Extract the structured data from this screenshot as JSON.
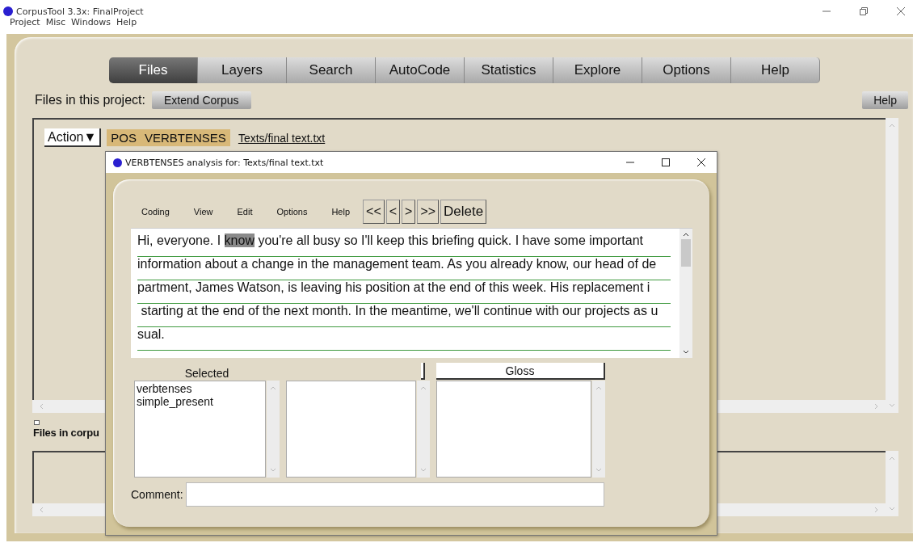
{
  "window": {
    "title": "CorpusTool 3.3x: FinalProject"
  },
  "menu": [
    "Project",
    "Misc",
    "Windows",
    "Help"
  ],
  "tabs": [
    {
      "label": "Files",
      "selected": true
    },
    {
      "label": "Layers",
      "selected": false
    },
    {
      "label": "Search",
      "selected": false
    },
    {
      "label": "AutoCode",
      "selected": false
    },
    {
      "label": "Statistics",
      "selected": false
    },
    {
      "label": "Explore",
      "selected": false
    },
    {
      "label": "Options",
      "selected": false
    },
    {
      "label": "Help",
      "selected": false
    }
  ],
  "files_bar": {
    "label": "Files in this project:",
    "button": "Extend Corpus",
    "help": "Help"
  },
  "file_row": {
    "action": "Action▼",
    "layers": [
      "POS",
      "VERBTENSES"
    ],
    "file": "Texts/final text.txt"
  },
  "corpus_label": "Files in corpu",
  "dialog": {
    "title": "VERBTENSES analysis for: Texts/final text.txt",
    "menu": [
      "Coding",
      "View",
      "Edit",
      "Options",
      "Help"
    ],
    "nav_buttons": [
      "<<",
      "<",
      ">",
      ">>"
    ],
    "delete": "Delete",
    "lines": [
      {
        "segments": [
          {
            "text": "Hi, everyone. I ",
            "highlighted": false
          },
          {
            "text": "know",
            "highlighted": true
          },
          {
            "text": " you're all busy so I'll keep this briefing quick. I have some important",
            "highlighted": false
          }
        ]
      },
      {
        "segments": [
          {
            "text": "information about a change in the management team. As you already know, our head of de",
            "highlighted": false
          }
        ]
      },
      {
        "segments": [
          {
            "text": "partment, James Watson, is leaving his position at the end of this week. His replacement i",
            "highlighted": false
          }
        ]
      },
      {
        "segments": [
          {
            "text": " starting at the end of the next month. In the meantime, we'll continue with our projects as u",
            "highlighted": false
          }
        ]
      },
      {
        "segments": [
          {
            "text": "sual.",
            "highlighted": false
          }
        ]
      }
    ],
    "lists": [
      {
        "kind": "label",
        "header": "Selected",
        "items": [
          "verbtenses",
          "simple_present"
        ]
      },
      {
        "kind": "blank"
      },
      {
        "kind": "button",
        "header": "Gloss"
      }
    ],
    "comment_label": "Comment:"
  }
}
